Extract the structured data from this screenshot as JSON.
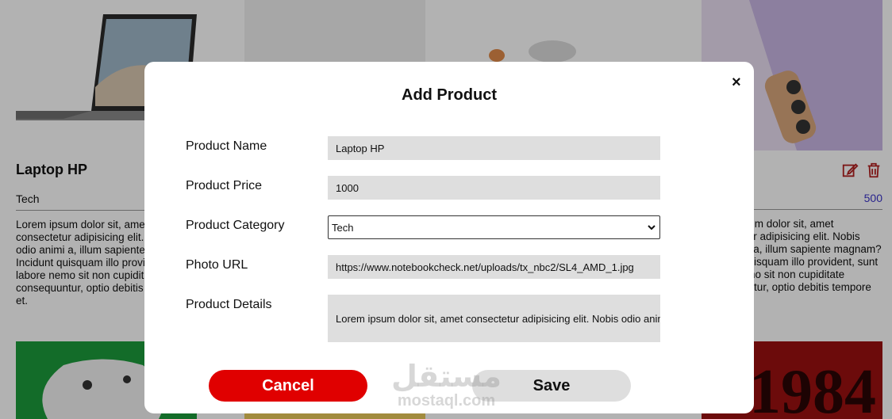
{
  "background": {
    "card1": {
      "title": "Laptop HP",
      "category": "Tech",
      "description": "Lorem ipsum dolor sit, amet consectetur adipisicing elit. Nobis odio animi a, illum sapiente magnam? Incidunt quisquam illo provident, sunt labore nemo sit non cupiditate consequuntur, optio debitis tempore et."
    },
    "card4": {
      "price": "500",
      "description": "Lorem ipsum dolor sit, amet consectetur adipisicing elit. Nobis odio animi a, illum sapiente magnam? Incidunt quisquam illo provident, sunt labore nemo sit non cupiditate consequuntur, optio debitis tempore et."
    },
    "colors": {
      "row2_card1": "#1c9b3c",
      "row2_card2": "#e8c85a",
      "row2_card4": "#9b1010"
    }
  },
  "modal": {
    "title": "Add Product",
    "close_icon": "×",
    "fields": {
      "name": {
        "label": "Product Name",
        "value": "Laptop HP"
      },
      "price": {
        "label": "Product Price",
        "value": "1000"
      },
      "category": {
        "label": "Product Category",
        "value": "Tech"
      },
      "photo": {
        "label": "Photo URL",
        "value": "https://www.notebookcheck.net/uploads/tx_nbc2/SL4_AMD_1.jpg"
      },
      "details": {
        "label": "Product Details",
        "value": "Lorem ipsum dolor sit, amet consectetur adipisicing elit. Nobis odio animi a"
      }
    },
    "buttons": {
      "cancel": "Cancel",
      "save": "Save"
    },
    "colors": {
      "cancel": "#e00000",
      "save": "#dedede"
    }
  },
  "watermark": {
    "arabic": "مستقل",
    "latin": "mostaql.com"
  }
}
